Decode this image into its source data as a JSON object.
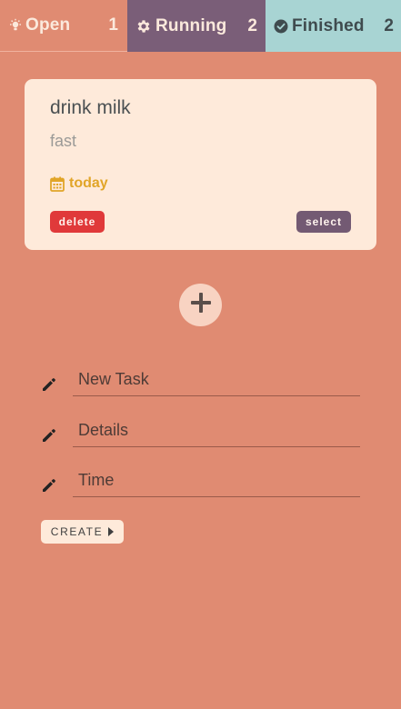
{
  "tabs": {
    "open": {
      "label": "Open",
      "count": "1",
      "icon": "lightbulb-icon"
    },
    "running": {
      "label": "Running",
      "count": "2",
      "icon": "gear-icon"
    },
    "finished": {
      "label": "Finished",
      "count": "2",
      "icon": "check-circle-icon"
    }
  },
  "task": {
    "title": "drink milk",
    "details": "fast",
    "time": "today",
    "delete_label": "delete",
    "select_label": "select"
  },
  "form": {
    "task_placeholder": "New Task",
    "details_placeholder": "Details",
    "time_placeholder": "Time",
    "create_label": "CREATE"
  },
  "colors": {
    "background": "#e08b72",
    "running_tab": "#7a5e78",
    "finished_tab": "#a8d4d3",
    "card": "#feeada",
    "delete": "#e0393a",
    "select": "#735a73",
    "time_accent": "#e1a528"
  }
}
